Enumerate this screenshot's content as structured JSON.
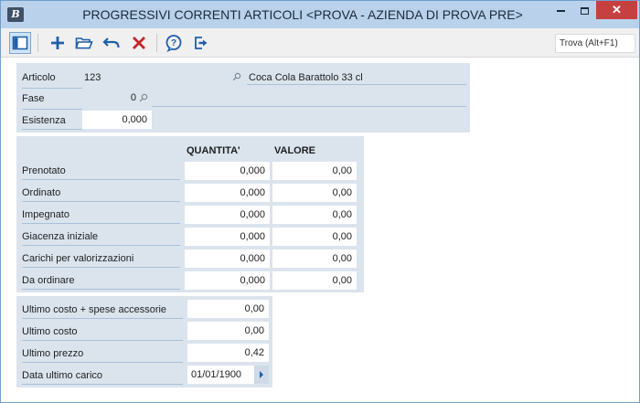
{
  "window": {
    "title": "PROGRESSIVI CORRENTI ARTICOLI <PROVA - AZIENDA DI PROVA PRE>",
    "app_icon_text": "B",
    "close_glyph": "✕"
  },
  "toolbar": {
    "buttons": [
      "toggle-panel-icon",
      "new-icon",
      "open-folder-icon",
      "undo-icon",
      "delete-icon",
      "help-icon",
      "exit-icon"
    ],
    "find_label": "Trova (Alt+F1)"
  },
  "header": {
    "articolo_label": "Articolo",
    "articolo_code": "123",
    "articolo_description": "Coca Cola Barattolo 33 cl",
    "fase_label": "Fase",
    "fase_value": "0",
    "esistenza_label": "Esistenza",
    "esistenza_value": "0,000"
  },
  "progressivi": {
    "col_quantita": "QUANTITA'",
    "col_valore": "VALORE",
    "rows": [
      {
        "label": "Prenotato",
        "quantita": "0,000",
        "valore": "0,00"
      },
      {
        "label": "Ordinato",
        "quantita": "0,000",
        "valore": "0,00"
      },
      {
        "label": "Impegnato",
        "quantita": "0,000",
        "valore": "0,00"
      },
      {
        "label": "Giacenza iniziale",
        "quantita": "0,000",
        "valore": "0,00"
      },
      {
        "label": "Carichi per valorizzazioni",
        "quantita": "0,000",
        "valore": "0,00"
      },
      {
        "label": "Da ordinare",
        "quantita": "0,000",
        "valore": "0,00"
      }
    ]
  },
  "costi": {
    "rows": [
      {
        "label": "Ultimo costo + spese accessorie",
        "value": "0,00"
      },
      {
        "label": "Ultimo costo",
        "value": "0,00"
      },
      {
        "label": "Ultimo prezzo",
        "value": "0,42"
      },
      {
        "label": "Data ultimo carico",
        "value": "01/01/1900"
      }
    ]
  },
  "colors": {
    "titlebar": "#b9d1ea",
    "panel": "#dbe4ed",
    "close_button": "#c74040",
    "accent_blue": "#1f5fa8",
    "delete_red": "#c0282d"
  }
}
